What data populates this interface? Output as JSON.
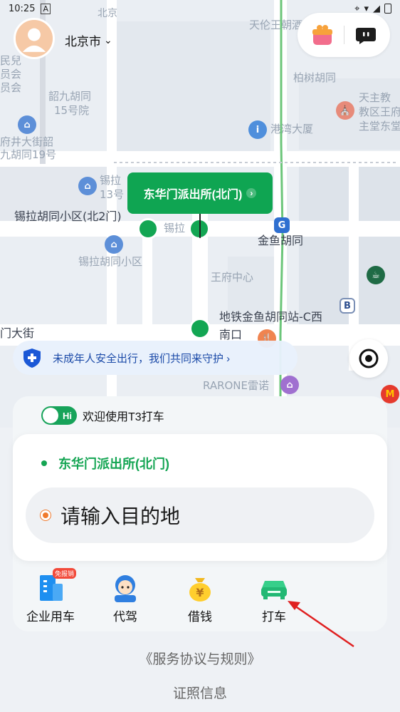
{
  "status_bar": {
    "time": "10:25",
    "battery_icon": "battery-icon",
    "wifi_icon": "wifi-icon",
    "signal_icon": "signal-icon",
    "location_icon": "location-icon"
  },
  "header": {
    "city": "北京市",
    "avatar_icon": "avatar-icon",
    "gift_icon": "gift-icon",
    "chat_icon": "chat-icon"
  },
  "map": {
    "labels": [
      "天伦王朝酒店",
      "北京",
      "民兒",
      "员会",
      "员会",
      "韶九胡同",
      "15号院",
      "府井大街韶",
      "九胡同19号",
      "柏树胡同",
      "天主教",
      "教区王府",
      "主堂东堂",
      "港湾大厦",
      "锡拉",
      "13号",
      "锡拉胡同小区(北2门)",
      "锡拉",
      "金鱼胡同",
      "锡拉胡同小区",
      "王府中心",
      "地铁金鱼胡同站-C西",
      "南口",
      "门大街",
      "RARONE雷诺"
    ],
    "pickup_label": "东华门派出所(北门)"
  },
  "safety_banner": {
    "text": "未成年人安全出行，我们共同来守护 ›"
  },
  "panel": {
    "welcome_badge": "Hi",
    "welcome_text": "欢迎使用T3打车",
    "pickup": "东华门派出所(北门)",
    "destination_placeholder": "请输入目的地",
    "services": [
      {
        "label": "企业用车",
        "badge": "免报销",
        "icon": "enterprise-car-icon"
      },
      {
        "label": "代驾",
        "icon": "designated-driver-icon"
      },
      {
        "label": "借钱",
        "icon": "money-bag-icon"
      },
      {
        "label": "打车",
        "icon": "taxi-car-icon"
      }
    ]
  },
  "footer": {
    "agreement": "《服务协议与规则》",
    "license": "证照信息"
  },
  "colors": {
    "brand_green": "#13a653",
    "banner_blue": "#1b4aa8",
    "annotation_red": "#e02020",
    "destination_orange": "#f07a2d"
  }
}
